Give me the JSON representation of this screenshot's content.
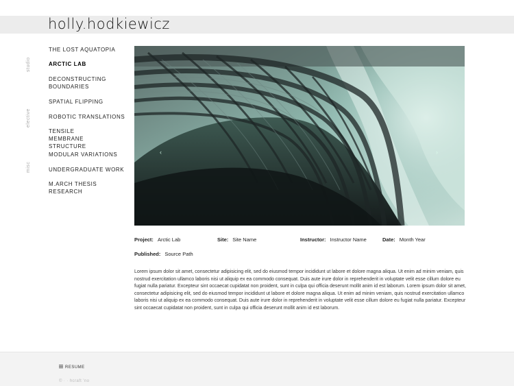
{
  "site": {
    "title": "holly.hodkiewicz"
  },
  "sidebar": {
    "section_labels": [
      "studio",
      "elective",
      "misc"
    ],
    "items": [
      {
        "label": "THE LOST AQUATOPIA"
      },
      {
        "label": "ARCTIC LAB",
        "active": true
      },
      {
        "label": "DECONSTRUCTING BOUNDARIES"
      },
      {
        "label": "SPATIAL FLIPPING"
      },
      {
        "label": "ROBOTIC TRANSLATIONS"
      },
      {
        "label": "TENSILE MEMBRANE STRUCTURE"
      },
      {
        "label": "MODULAR VARIATIONS"
      },
      {
        "label": "UNDERGRADUATE WORK"
      },
      {
        "label": "M.ARCH THESIS RESEARCH"
      }
    ]
  },
  "hero": {
    "prev_glyph": "‹",
    "next_glyph": "›"
  },
  "project": {
    "project_label": "Project:",
    "project_value": "Arctic Lab",
    "site_label": "Site:",
    "site_value": "Site Name",
    "instructor_label": "Instructor:",
    "instructor_value": "Instructor Name",
    "date_label": "Date:",
    "date_value": "Month Year",
    "published_label": "Published:",
    "published_value": "Source Path",
    "description": "Lorem ipsum dolor sit amet, consectetur adipisicing elit, sed do eiusmod tempor incididunt ut labore et dolore magna aliqua. Ut enim ad minim veniam, quis nostrud exercitation ullamco laboris nisi ut aliquip ex ea commodo consequat. Duis aute irure dolor in reprehenderit in voluptate velit esse cillum dolore eu fugiat nulla pariatur. Excepteur sint occaecat cupidatat non proident, sunt in culpa qui officia deserunt mollit anim id est laborum. Lorem ipsum dolor sit amet, consectetur adipisicing elit, sed do eiusmod tempor incididunt ut labore et dolore magna aliqua. Ut enim ad minim veniam, quis nostrud exercitation ullamco laboris nisi ut aliquip ex ea commodo consequat. Duis aute irure dolor in reprehenderit in voluptate velit esse cillum dolore eu fugiat nulla pariatur. Excepteur sint occaecat cupidatat non proident, sunt in culpa qui officia deserunt mollit anim id est laborum."
  },
  "footer": {
    "resume_label": "RESUME",
    "menu_icon": "menu-icon",
    "note": "© · · hcraft 'no"
  },
  "colors": {
    "header_band": "#ececec",
    "footer_bg": "#f3f3f3",
    "aurora": "#9ec8bf",
    "sky_dark": "#2a3a3c"
  }
}
